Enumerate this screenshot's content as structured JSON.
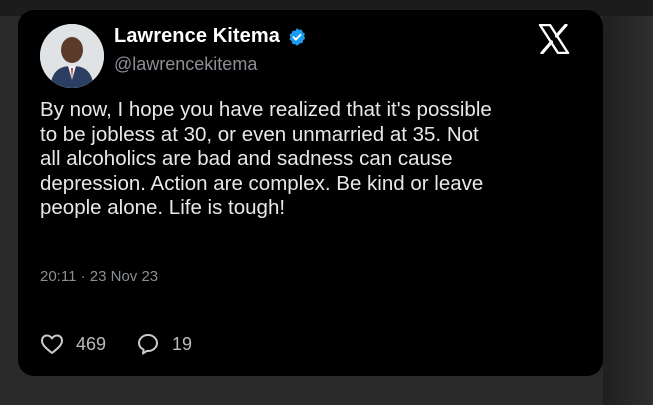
{
  "tweet": {
    "author_name": "Lawrence Kitema",
    "author_handle": "@lawrencekitema",
    "body": "By now, I hope you have realized that it's possible\nto be jobless at 30, or even unmarried at 35. Not\nall alcoholics are bad and sadness can cause\ndepression. Action are complex. Be kind or leave\npeople alone. Life is tough!",
    "timestamp": "20:11 · 23 Nov 23",
    "likes": "469",
    "replies": "19"
  },
  "icons": {
    "verified": "verified-badge-icon",
    "logo": "x-logo-icon",
    "like": "heart-icon",
    "reply": "speech-bubble-icon"
  },
  "colors": {
    "background": "#000000",
    "text": "#e8e8e8",
    "secondary_text": "#8b8f94",
    "verified_blue": "#1d9bf0"
  }
}
